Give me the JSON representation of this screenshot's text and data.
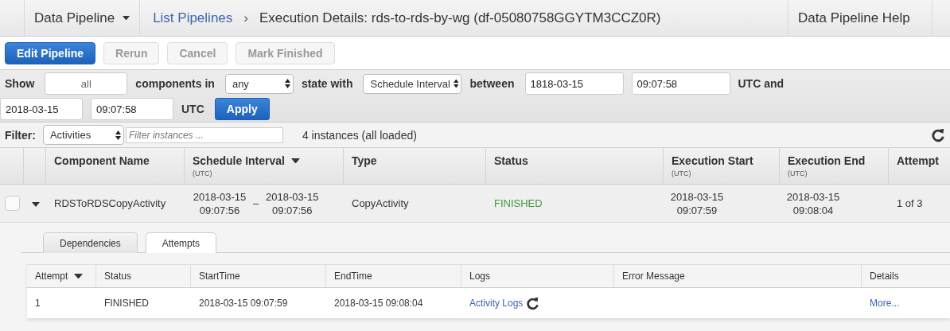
{
  "nav": {
    "menu": "Data Pipeline",
    "breadcrumb": "List Pipelines",
    "separator": "›",
    "title": "Execution Details: rds-to-rds-by-wg (df-05080758GGYTM3CCZ0R)",
    "help": "Data Pipeline Help"
  },
  "actions": [
    {
      "label": "Edit Pipeline",
      "disabled": false,
      "primary": true
    },
    {
      "label": "Rerun",
      "disabled": true,
      "primary": false
    },
    {
      "label": "Cancel",
      "disabled": true,
      "primary": false
    },
    {
      "label": "Mark Finished",
      "disabled": true,
      "primary": false
    }
  ],
  "query": {
    "rows": [
      [
        {
          "kind": "label",
          "text": "Show"
        },
        {
          "kind": "input",
          "value": "all"
        },
        {
          "kind": "label",
          "text": "components in"
        },
        {
          "kind": "select",
          "value": "any"
        },
        {
          "kind": "label",
          "text": "state with"
        },
        {
          "kind": "select",
          "value": "Schedule Interval"
        },
        {
          "kind": "label",
          "text": "between"
        },
        {
          "kind": "input",
          "value": "1818-03-15"
        },
        {
          "kind": "input",
          "value": "09:07:58"
        },
        {
          "kind": "label",
          "text": "UTC and"
        }
      ],
      [
        {
          "kind": "input",
          "value": "2018-03-15"
        },
        {
          "kind": "input",
          "value": "09:07:58"
        },
        {
          "kind": "label",
          "text": "UTC"
        },
        {
          "kind": "button",
          "text": "Apply"
        }
      ]
    ]
  },
  "filter": {
    "label": "Filter:",
    "select": "Activities",
    "placeholder": "Filter instances ...",
    "count": "4 instances (all loaded)"
  },
  "table": {
    "columns": [
      {
        "title": "Component Name",
        "sorted": false
      },
      {
        "title": "Schedule Interval",
        "sub": "(UTC)",
        "sorted": true
      },
      {
        "title": "Type",
        "sorted": false
      },
      {
        "title": "Status",
        "sorted": false
      },
      {
        "title": "Execution Start",
        "sub": "(UTC)",
        "sorted": false
      },
      {
        "title": "Execution End",
        "sub": "(UTC)",
        "sorted": false
      },
      {
        "title": "Attempt",
        "sorted": false
      }
    ],
    "rows": [
      {
        "checked": false,
        "expanded": true,
        "name": "RDSToRDSCopyActivity",
        "interval_start": "2018-03-15 09:07:56",
        "interval_separator": "–",
        "interval_end": "2018-03-15 09:07:56",
        "type": "CopyActivity",
        "status": "FINISHED",
        "exec_start": "2018-03-15 09:07:59",
        "exec_end": "2018-03-15 09:08:04",
        "attempt": "1 of 3"
      }
    ]
  },
  "detail": {
    "tabs": [
      {
        "label": "Dependencies",
        "selected": false
      },
      {
        "label": "Attempts",
        "selected": true
      }
    ],
    "columns": [
      {
        "title": "Attempt",
        "sorted": true
      },
      {
        "title": "Status",
        "sorted": false
      },
      {
        "title": "StartTime",
        "sorted": false
      },
      {
        "title": "EndTime",
        "sorted": false
      },
      {
        "title": "Logs",
        "sorted": false
      },
      {
        "title": "Error Message",
        "sorted": false
      },
      {
        "title": "Details",
        "sorted": false
      }
    ],
    "rows": [
      {
        "attempt": "1",
        "status": "FINISHED",
        "start": "2018-03-15 09:07:59",
        "end": "2018-03-15 09:08:04",
        "logs": "Activity Logs",
        "details": "More..."
      }
    ]
  }
}
